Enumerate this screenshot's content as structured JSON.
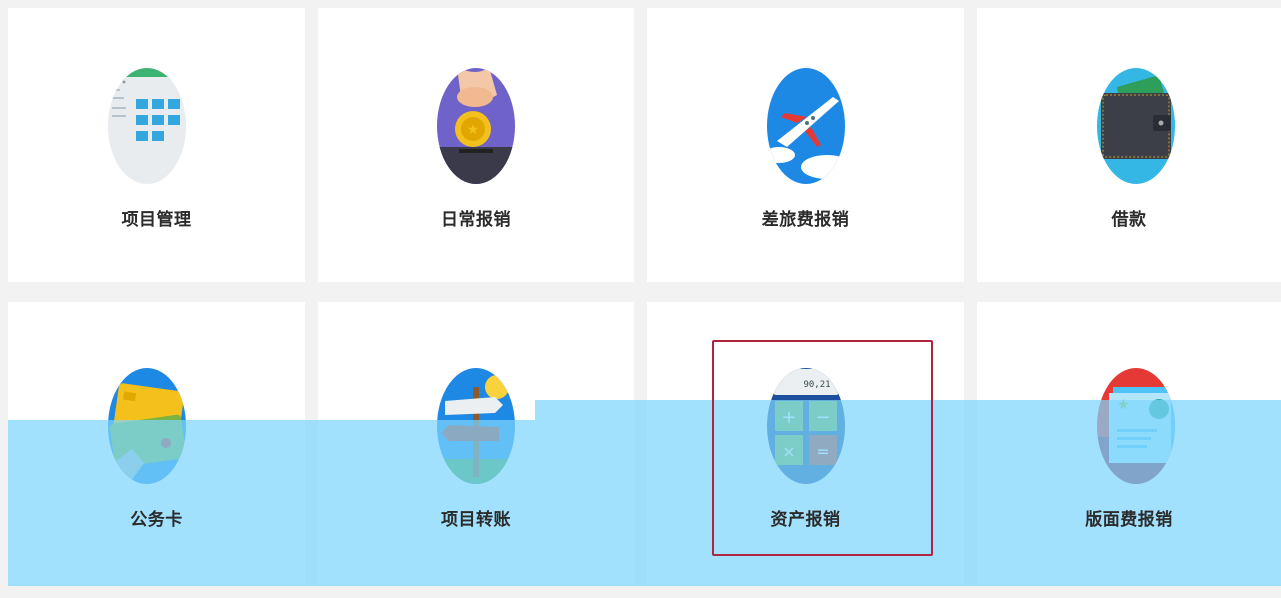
{
  "tiles": [
    {
      "label": "项目管理",
      "icon": "building-calendar-icon"
    },
    {
      "label": "日常报销",
      "icon": "coin-hand-icon"
    },
    {
      "label": "差旅费报销",
      "icon": "airplane-icon"
    },
    {
      "label": "借款",
      "icon": "wallet-icon"
    },
    {
      "label": "公务卡",
      "icon": "credit-card-icon"
    },
    {
      "label": "项目转账",
      "icon": "signpost-icon"
    },
    {
      "label": "资产报销",
      "icon": "calculator-icon",
      "calculator_display": "90,21"
    },
    {
      "label": "版面费报销",
      "icon": "document-star-icon"
    }
  ],
  "colors": {
    "overlay": "#7dd5fc",
    "highlight_border": "#b0243f"
  }
}
